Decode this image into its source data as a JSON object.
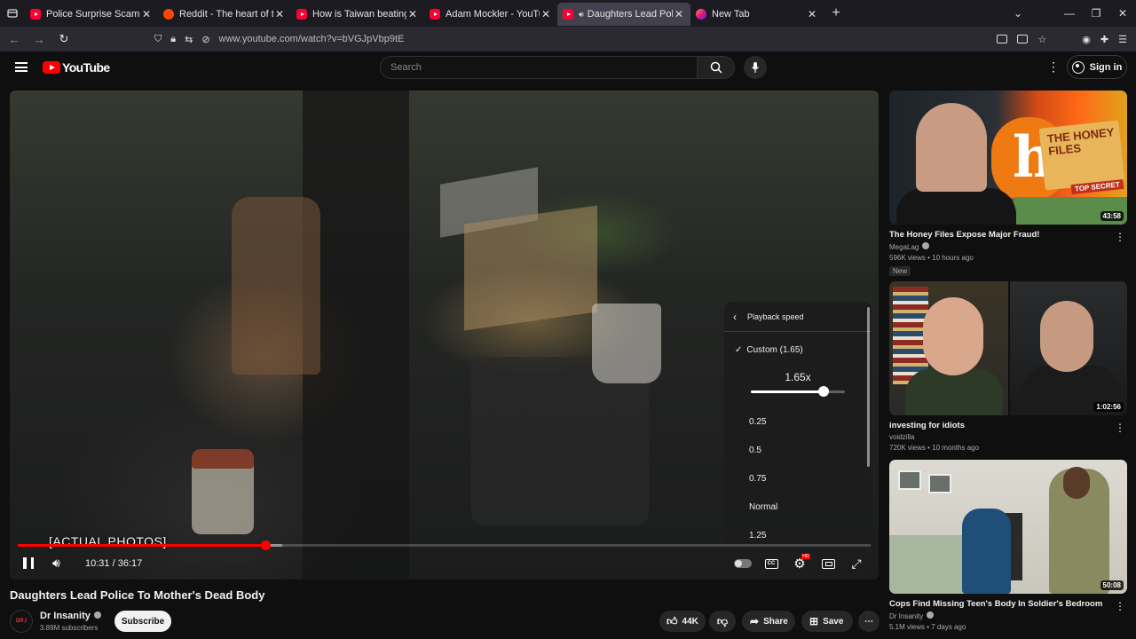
{
  "browser": {
    "tabs": [
      {
        "title": "Police Surprise Scammers At Th",
        "favicon": "youtube-icon",
        "active": false
      },
      {
        "title": "Reddit - The heart of the intern",
        "favicon": "reddit-icon",
        "active": false
      },
      {
        "title": "How is Taiwan beating everyone",
        "favicon": "youtube-icon",
        "active": false
      },
      {
        "title": "Adam Mockler - YouTube",
        "favicon": "youtube-icon",
        "active": false
      },
      {
        "title": "Daughters Lead Police To M",
        "favicon": "youtube-icon",
        "active": true,
        "playing": true
      },
      {
        "title": "New Tab",
        "favicon": "firefox-icon",
        "active": false
      }
    ],
    "url_host": "www.youtube.com",
    "url_path": "/watch?v=bVGJpVbp9tE"
  },
  "header": {
    "logo_text": "YouTube",
    "search_placeholder": "Search",
    "signin_label": "Sign in"
  },
  "player": {
    "caption": "[ACTUAL PHOTOS]",
    "time_current": "10:31",
    "time_total": "36:17",
    "played_fraction": 0.29,
    "buffered_fraction": 0.31,
    "hd_badge": "HD",
    "cc_label": "CC",
    "speed_menu": {
      "title": "Playback speed",
      "custom_label": "Custom (1.65)",
      "current_value": "1.65x",
      "slider_fraction": 0.77,
      "options": [
        "0.25",
        "0.5",
        "0.75",
        "Normal",
        "1.25"
      ]
    }
  },
  "video": {
    "title": "Daughters Lead Police To Mother's Dead Body",
    "channel": "Dr Insanity",
    "avatar_text": "DR.I",
    "subscribers": "3.89M subscribers",
    "subscribe_label": "Subscribe",
    "likes": "44K",
    "share_label": "Share",
    "save_label": "Save"
  },
  "sidebar": [
    {
      "title": "The Honey Files Expose Major Fraud!",
      "channel": "MegaLag",
      "meta": "596K views • 10 hours ago",
      "badge": "New",
      "duration": "43:58",
      "thumb_text": "THE HONEY FILES",
      "thumb_letter": "h",
      "thumb_stamp": "TOP SECRET"
    },
    {
      "title": "investing for idiots",
      "channel": "voidzilla",
      "meta": "720K views • 10 months ago",
      "duration": "1:02:56"
    },
    {
      "title": "Cops Find Missing Teen's Body In Soldier's Bedroom",
      "channel": "Dr Insanity",
      "meta": "5.1M views • 7 days ago",
      "duration": "50:08"
    }
  ],
  "colors": {
    "accent": "#ff0000",
    "background": "#0f0f0f",
    "chrome_tabbar": "#1c1b22",
    "chrome_urlbar": "#2b2a33"
  }
}
